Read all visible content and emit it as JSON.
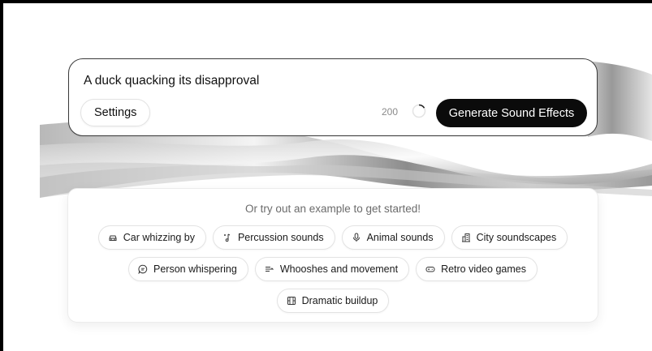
{
  "prompt": {
    "text": "A duck quacking its disapproval",
    "settings_label": "Settings",
    "char_count": "200",
    "generate_label": "Generate Sound Effects"
  },
  "examples": {
    "heading": "Or try out an example to get started!",
    "chips": [
      {
        "label": "Car whizzing by",
        "icon": "car-icon"
      },
      {
        "label": "Percussion sounds",
        "icon": "music-note-icon"
      },
      {
        "label": "Animal sounds",
        "icon": "microphone-icon"
      },
      {
        "label": "City soundscapes",
        "icon": "building-icon"
      },
      {
        "label": "Person whispering",
        "icon": "chat-bubble-icon"
      },
      {
        "label": "Whooshes and movement",
        "icon": "wind-icon"
      },
      {
        "label": "Retro video games",
        "icon": "gamepad-icon"
      },
      {
        "label": "Dramatic buildup",
        "icon": "film-icon"
      }
    ]
  },
  "colors": {
    "generate_button_bg": "#0b0b0b",
    "card_border": "#3a3a3a",
    "muted_text": "#6b6b6b"
  }
}
